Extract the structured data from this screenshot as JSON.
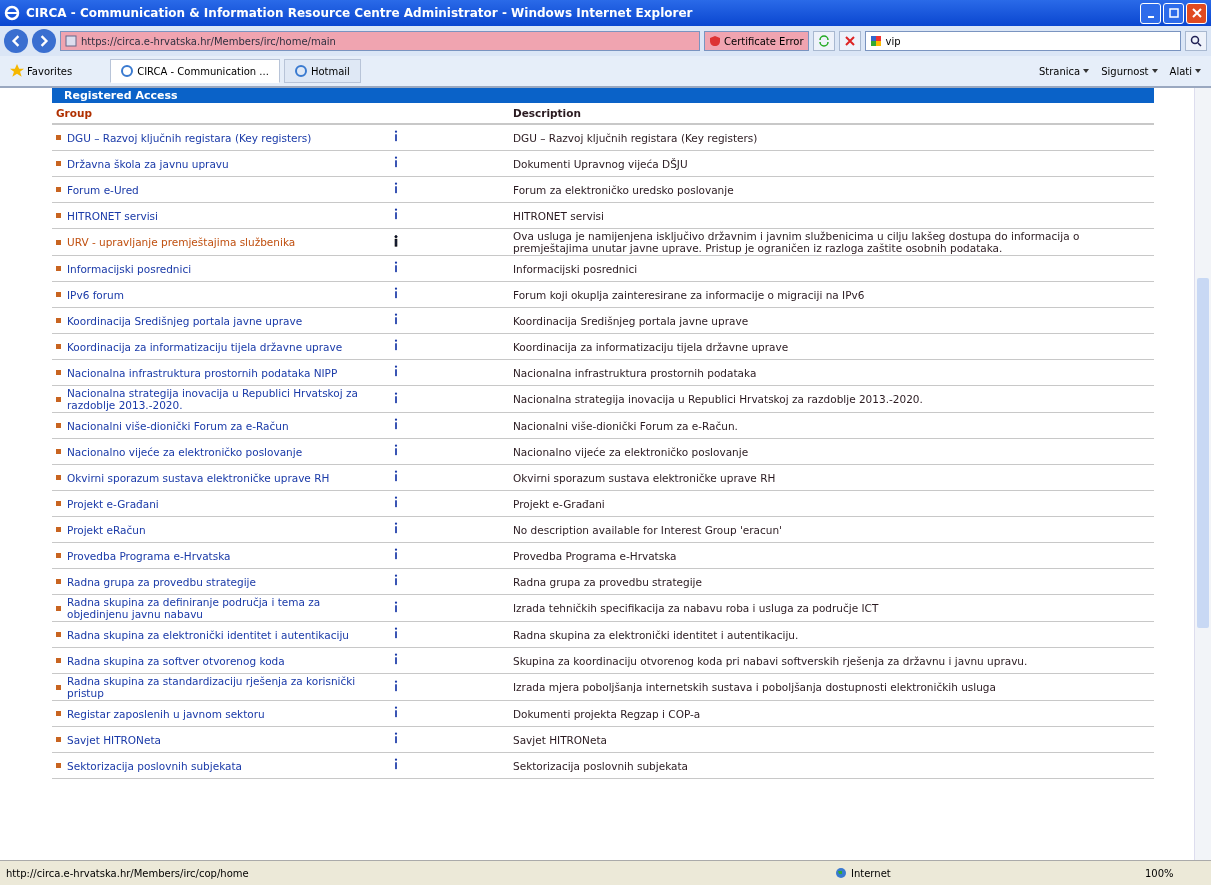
{
  "window": {
    "title": "CIRCA - Communication & Information Resource Centre Administrator - Windows Internet Explorer"
  },
  "address_bar": {
    "url": "https://circa.e-hrvatska.hr/Members/irc/home/main",
    "certificate": "Certificate Error"
  },
  "search": {
    "value": "vip"
  },
  "favorites": "Favorites",
  "tabs": [
    {
      "label": "CIRCA - Communication ...",
      "selected": true
    },
    {
      "label": "Hotmail",
      "selected": false
    }
  ],
  "command_bar": [
    "Stranica",
    "Sigurnost",
    "Alati"
  ],
  "section": {
    "title": "Registered Access",
    "columns": [
      "Group",
      "Description"
    ]
  },
  "rows": [
    {
      "group": "DGU – Razvoj ključnih registara (Key registers)",
      "description": "DGU – Razvoj ključnih registara (Key registers)",
      "selected": false
    },
    {
      "group": "Državna škola za javnu upravu",
      "description": "Dokumenti Upravnog vijeća DŠJU",
      "selected": false
    },
    {
      "group": "Forum e-Ured",
      "description": "Forum za elektroničko uredsko poslovanje",
      "selected": false
    },
    {
      "group": "HITRONET servisi",
      "description": "HITRONET servisi",
      "selected": false
    },
    {
      "group": "URV - upravljanje premještajima službenika",
      "description": "Ova usluga je namijenjena isključivo državnim i javnim službenicima u cilju lakšeg dostupa do informacija o premještajima unutar javne uprave. Pristup je ograničen iz razloga zaštite osobnih podataka.",
      "selected": true
    },
    {
      "group": "Informacijski posrednici",
      "description": "Informacijski posrednici",
      "selected": false
    },
    {
      "group": "IPv6 forum",
      "description": "Forum koji okuplja zainteresirane za informacije o migraciji na IPv6",
      "selected": false
    },
    {
      "group": "Koordinacija Središnjeg portala javne uprave",
      "description": "Koordinacija Središnjeg portala javne uprave",
      "selected": false
    },
    {
      "group": "Koordinacija za informatizaciju tijela državne uprave",
      "description": "Koordinacija za informatizaciju tijela državne uprave",
      "selected": false
    },
    {
      "group": "Nacionalna infrastruktura prostornih podataka NIPP",
      "description": "Nacionalna infrastruktura prostornih podataka",
      "selected": false
    },
    {
      "group": "Nacionalna strategija inovacija u Republici Hrvatskoj za razdoblje 2013.-2020.",
      "description": "Nacionalna strategija inovacija u Republici Hrvatskoj za razdoblje 2013.-2020.",
      "selected": false
    },
    {
      "group": "Nacionalni više-dionički Forum za e-Račun",
      "description": "Nacionalni više-dionički Forum za e-Račun.",
      "selected": false
    },
    {
      "group": "Nacionalno vijeće za elektroničko poslovanje",
      "description": "Nacionalno vijeće za elektroničko poslovanje",
      "selected": false
    },
    {
      "group": "Okvirni sporazum sustava elektroničke uprave RH",
      "description": "Okvirni sporazum sustava elektroničke uprave RH",
      "selected": false
    },
    {
      "group": "Projekt e-Građani",
      "description": "Projekt e-Građani",
      "selected": false
    },
    {
      "group": "Projekt eRačun",
      "description": "No description available for Interest Group 'eracun'",
      "selected": false
    },
    {
      "group": "Provedba Programa e-Hrvatska",
      "description": "Provedba Programa e-Hrvatska",
      "selected": false
    },
    {
      "group": "Radna grupa za provedbu strategije",
      "description": "Radna grupa za provedbu strategije",
      "selected": false
    },
    {
      "group": "Radna skupina za definiranje područja i tema za objedinjenu javnu nabavu",
      "description": "Izrada tehničkih specifikacija za nabavu roba i usluga za područje ICT",
      "selected": false
    },
    {
      "group": "Radna skupina za elektronički identitet i autentikaciju",
      "description": "Radna skupina za elektronički identitet i autentikaciju.",
      "selected": false
    },
    {
      "group": "Radna skupina za softver otvorenog koda",
      "description": "Skupina za koordinaciju otvorenog koda pri nabavi softverskih rješenja za državnu i javnu upravu.",
      "selected": false
    },
    {
      "group": "Radna skupina za standardizaciju rješenja za korisnički pristup",
      "description": "Izrada mjera poboljšanja internetskih sustava i poboljšanja dostupnosti elektroničkih usluga",
      "selected": false
    },
    {
      "group": "Registar zaposlenih u javnom sektoru",
      "description": "Dokumenti projekta Regzap i COP-a",
      "selected": false
    },
    {
      "group": "Savjet HITRONeta",
      "description": "Savjet HITRONeta",
      "selected": false
    },
    {
      "group": "Sektorizacija poslovnih subjekata",
      "description": "Sektorizacija poslovnih subjekata",
      "selected": false
    }
  ],
  "status_bar": {
    "url": "http://circa.e-hrvatska.hr/Members/irc/cop/home",
    "zone": "Internet",
    "zoom": "100%"
  }
}
